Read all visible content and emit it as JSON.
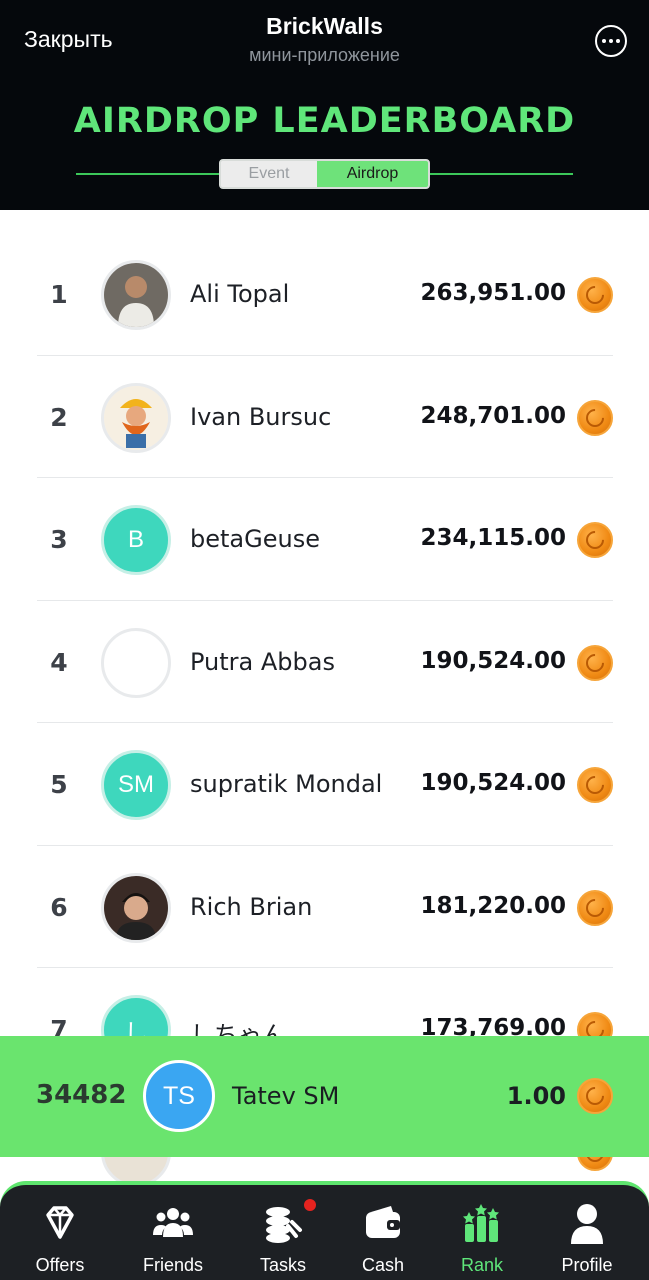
{
  "header": {
    "close_label": "Закрыть",
    "app_title": "BrickWalls",
    "app_subtitle": "мини-приложение",
    "leaderboard_title": "AIRDROP LEADERBOARD",
    "tabs": [
      {
        "label": "Event",
        "active": false
      },
      {
        "label": "Airdrop",
        "active": true
      }
    ]
  },
  "leaderboard": [
    {
      "rank": "1",
      "name": "Ali Topal",
      "score": "263,951.00",
      "avatar_type": "photo",
      "initials": ""
    },
    {
      "rank": "2",
      "name": "Ivan Bursuc",
      "score": "248,701.00",
      "avatar_type": "dwarf-illustration",
      "initials": ""
    },
    {
      "rank": "3",
      "name": "betaGeuse",
      "score": "234,115.00",
      "avatar_type": "initials",
      "initials": "B"
    },
    {
      "rank": "4",
      "name": "Putra Abbas",
      "score": "190,524.00",
      "avatar_type": "empty",
      "initials": ""
    },
    {
      "rank": "5",
      "name": "supratik Mondal",
      "score": "190,524.00",
      "avatar_type": "initials",
      "initials": "SM"
    },
    {
      "rank": "6",
      "name": "Rich Brian",
      "score": "181,220.00",
      "avatar_type": "photo",
      "initials": ""
    },
    {
      "rank": "7",
      "name": "しちゃん",
      "score": "173,769.00",
      "avatar_type": "initials",
      "initials": "し"
    }
  ],
  "current_user": {
    "rank": "34482",
    "initials": "TS",
    "name": "Tatev SM",
    "score": "1.00"
  },
  "colors": {
    "accent_green": "#5fe67a",
    "header_bg": "#05080c",
    "teal_avatar": "#3ed7bd",
    "user_avatar": "#3aa6f2",
    "coin": "#f08a14",
    "nav_bg": "#1d2024",
    "badge_red": "#e5231f"
  },
  "nav": {
    "items": [
      {
        "label": "Offers",
        "icon": "diamond-icon",
        "active": false
      },
      {
        "label": "Friends",
        "icon": "friends-icon",
        "active": false
      },
      {
        "label": "Tasks",
        "icon": "coins-tasks-icon",
        "active": false,
        "badge": true
      },
      {
        "label": "Cash",
        "icon": "wallet-icon",
        "active": false
      },
      {
        "label": "Rank",
        "icon": "rank-bars-icon",
        "active": true
      },
      {
        "label": "Profile",
        "icon": "person-icon",
        "active": false
      }
    ]
  }
}
